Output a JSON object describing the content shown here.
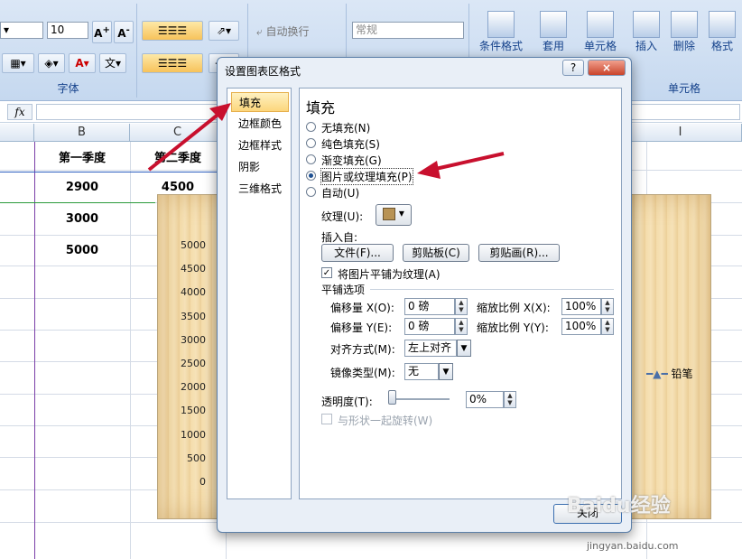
{
  "ribbon": {
    "font_size": "10",
    "font_group_label": "字体",
    "wrap_text": "自动换行",
    "number_format": "常规",
    "conditional_format": "条件格式",
    "table_format": "套用",
    "cell_style": "单元格",
    "insert": "插入",
    "delete": "删除",
    "format": "格式",
    "cells_group_label": "单元格"
  },
  "formula_bar": {
    "fx": "fx"
  },
  "sheet": {
    "columns": [
      "B",
      "C",
      "I"
    ],
    "headers": [
      "第一季度",
      "第二季度"
    ],
    "values_b": [
      "2900",
      "3000",
      "5000"
    ],
    "value_c1": "4500"
  },
  "chart": {
    "y_ticks": [
      "5000",
      "4500",
      "4000",
      "3500",
      "3000",
      "2500",
      "2000",
      "1500",
      "1000",
      "500",
      "0"
    ],
    "legend": "铅笔"
  },
  "dialog": {
    "title": "设置图表区格式",
    "help": "?",
    "close": "×",
    "nav": [
      "填充",
      "边框颜色",
      "边框样式",
      "阴影",
      "三维格式"
    ],
    "panel_title": "填充",
    "options": [
      "无填充(N)",
      "纯色填充(S)",
      "渐变填充(G)",
      "图片或纹理填充(P)",
      "自动(U)"
    ],
    "texture_label": "纹理(U):",
    "insert_from": "插入自:",
    "file_btn": "文件(F)...",
    "clipboard_btn": "剪贴板(C)",
    "clipart_btn": "剪贴画(R)...",
    "tile_checkbox": "将图片平铺为纹理(A)",
    "tile_options": "平铺选项",
    "offset_x_label": "偏移量 X(O):",
    "offset_x": "0 磅",
    "scale_x_label": "缩放比例 X(X):",
    "scale_x": "100%",
    "offset_y_label": "偏移量 Y(E):",
    "offset_y": "0 磅",
    "scale_y_label": "缩放比例 Y(Y):",
    "scale_y": "100%",
    "align_label": "对齐方式(M):",
    "align_value": "左上对齐",
    "mirror_label": "镜像类型(M):",
    "mirror_value": "无",
    "transparency_label": "透明度(T):",
    "transparency": "0%",
    "transparency_fraction": 0,
    "rotate_checkbox": "与形状一起旋转(W)",
    "close_btn": "关闭"
  },
  "watermark": {
    "text": "Baidu经验",
    "url": "jingyan.baidu.com"
  }
}
